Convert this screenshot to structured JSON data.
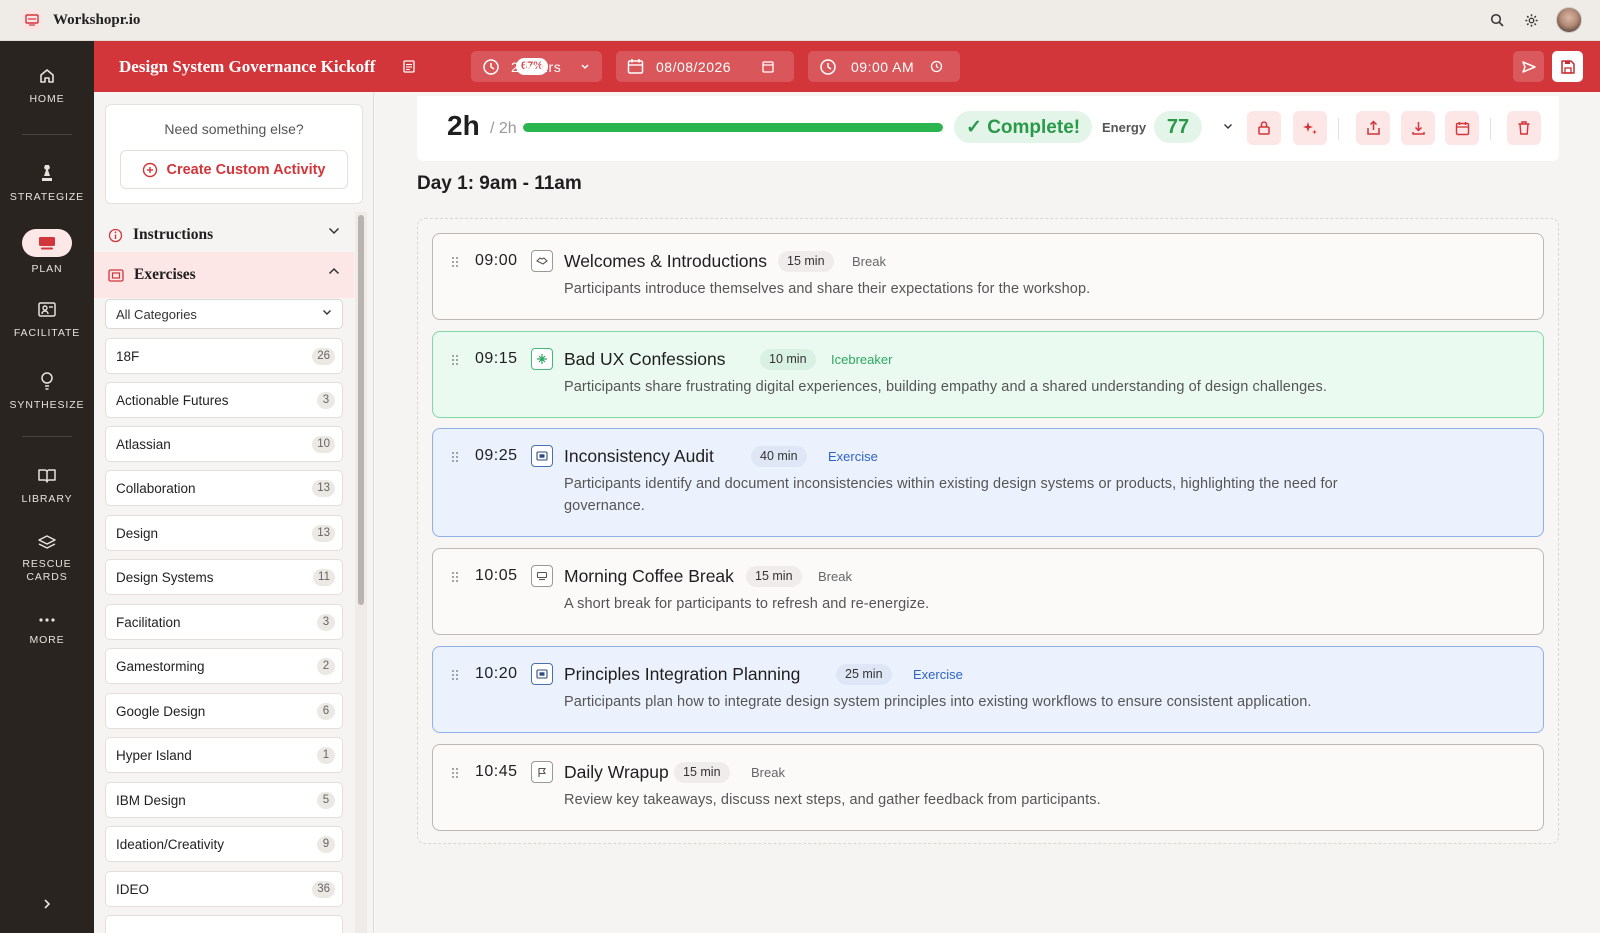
{
  "app": {
    "name": "Workshopr.io"
  },
  "rail": {
    "items": [
      {
        "key": "home",
        "label": "HOME"
      },
      {
        "key": "strategize",
        "label": "STRATEGIZE"
      },
      {
        "key": "plan",
        "label": "PLAN"
      },
      {
        "key": "facilitate",
        "label": "FACILITATE"
      },
      {
        "key": "synthesize",
        "label": "SYNTHESIZE"
      },
      {
        "key": "library",
        "label": "LIBRARY"
      },
      {
        "key": "rescue_cards",
        "label": "RESCUE\nCARDS"
      },
      {
        "key": "more",
        "label": "MORE"
      }
    ]
  },
  "header": {
    "title": "Design System Governance Kickoff",
    "percent": "67%",
    "duration": "2 hours",
    "date": "08/08/2026",
    "time": "09:00 AM"
  },
  "panel": {
    "need_text": "Need something else?",
    "create_label": "Create Custom Activity",
    "instructions_label": "Instructions",
    "exercises_label": "Exercises",
    "category_select": "All Categories",
    "categories": [
      {
        "name": "18F",
        "count": "26"
      },
      {
        "name": "Actionable Futures",
        "count": "3"
      },
      {
        "name": "Atlassian",
        "count": "10"
      },
      {
        "name": "Collaboration",
        "count": "13"
      },
      {
        "name": "Design",
        "count": "13"
      },
      {
        "name": "Design Systems",
        "count": "11"
      },
      {
        "name": "Facilitation",
        "count": "3"
      },
      {
        "name": "Gamestorming",
        "count": "2"
      },
      {
        "name": "Google Design",
        "count": "6"
      },
      {
        "name": "Hyper Island",
        "count": "1"
      },
      {
        "name": "IBM Design",
        "count": "5"
      },
      {
        "name": "Ideation/Creativity",
        "count": "9"
      },
      {
        "name": "IDEO",
        "count": "36"
      }
    ]
  },
  "status": {
    "total": "2h",
    "of_total": "/ 2h",
    "progress": 1.0,
    "complete_label": "✓ Complete!",
    "energy_label": "Energy",
    "energy_value": "77"
  },
  "day_title": "Day 1: 9am - 11am",
  "activities": [
    {
      "time": "09:00",
      "title": "Welcomes & Introductions",
      "duration": "15 min",
      "type": "Break",
      "kind": "break",
      "icon": "handshake-icon",
      "description": "Participants introduce themselves and share their expectations for the workshop."
    },
    {
      "time": "09:15",
      "title": "Bad UX Confessions",
      "duration": "10 min",
      "type": "Icebreaker",
      "kind": "ice",
      "icon": "sparkle-icon",
      "description": "Participants share frustrating digital experiences, building empathy and a shared understanding of design challenges."
    },
    {
      "time": "09:25",
      "title": "Inconsistency Audit",
      "duration": "40 min",
      "type": "Exercise",
      "kind": "exe",
      "icon": "ticket-icon",
      "description": "Participants identify and document inconsistencies within existing design systems or products, highlighting the need for governance."
    },
    {
      "time": "10:05",
      "title": "Morning Coffee Break",
      "duration": "15 min",
      "type": "Break",
      "kind": "break",
      "icon": "coffee-icon",
      "description": "A short break for participants to refresh and re-energize."
    },
    {
      "time": "10:20",
      "title": "Principles Integration Planning",
      "duration": "25 min",
      "type": "Exercise",
      "kind": "exe",
      "icon": "ticket-icon",
      "description": "Participants plan how to integrate design system principles into existing workflows to ensure consistent application."
    },
    {
      "time": "10:45",
      "title": "Daily Wrapup",
      "duration": "15 min",
      "type": "Break",
      "kind": "break",
      "icon": "flag-icon",
      "description": "Review key takeaways, discuss next steps, and gather feedback from participants."
    }
  ],
  "colors": {
    "brand": "#d2353a",
    "rail": "#2a2420",
    "success": "#2bb54f",
    "icebreaker": "#2ea763",
    "exercise": "#2d63c8"
  }
}
